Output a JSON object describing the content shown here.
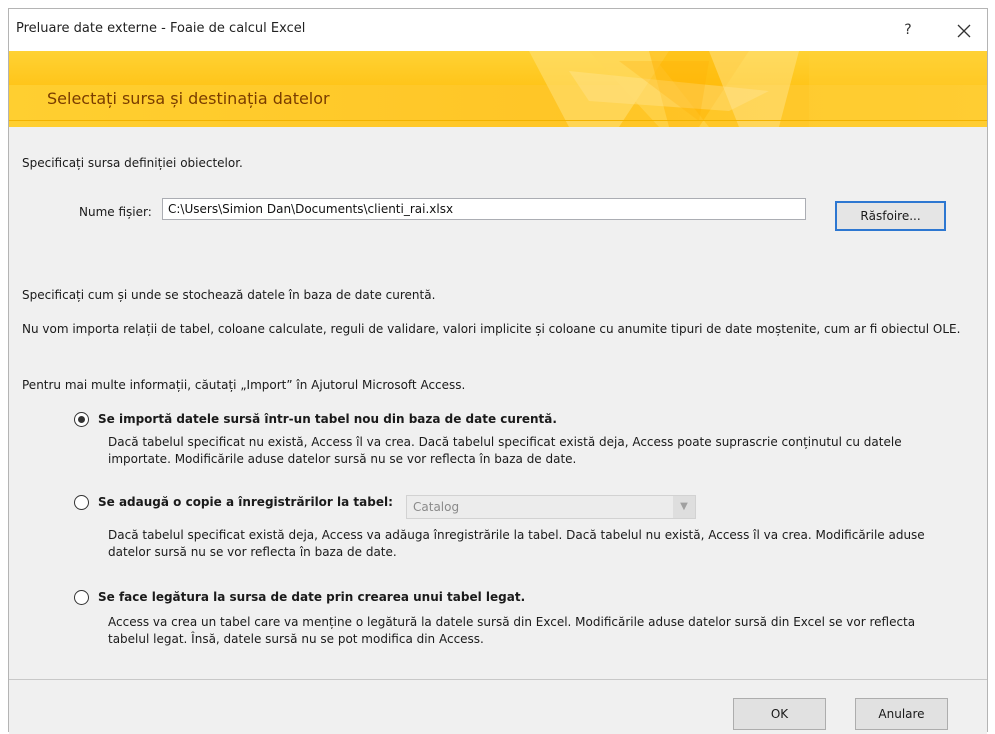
{
  "window": {
    "title": "Preluare date externe - Foaie de calcul Excel",
    "help_label": "?",
    "close_label": "✕"
  },
  "banner": {
    "title": "Selectați sursa și destinația datelor"
  },
  "source": {
    "instruction": "Specificați sursa definiției obiectelor.",
    "file_label": "Nume fișier:",
    "file_value": "C:\\Users\\Simion Dan\\Documents\\clienti_rai.xlsx",
    "browse_label": "Răsfoire..."
  },
  "storage": {
    "instruction": "Specificați cum și unde se stochează datele în baza de date curentă.",
    "note": "Nu vom importa relații de tabel, coloane calculate, reguli de validare, valori implicite și coloane cu anumite tipuri de date moștenite, cum ar fi obiectul OLE.",
    "help_hint": "Pentru mai multe informații, căutați „Import” în Ajutorul Microsoft Access."
  },
  "options": [
    {
      "label": "Se importă datele sursă într-un tabel nou din baza de date curentă.",
      "description": "Dacă tabelul specificat nu există, Access îl va crea. Dacă tabelul specificat există deja, Access poate suprascrie conținutul cu datele importate. Modificările aduse datelor sursă nu se vor reflecta în baza de date.",
      "checked": true
    },
    {
      "label": "Se adaugă o copie a înregistrărilor la tabel:",
      "description": "Dacă tabelul specificat există deja, Access va adăuga înregistrările la tabel. Dacă tabelul nu există, Access îl va crea. Modificările aduse datelor sursă nu se vor reflecta în baza de date.",
      "checked": false,
      "combo_value": "Catalog"
    },
    {
      "label": "Se face legătura la sursa de date prin crearea unui tabel legat.",
      "description": "Access va crea un tabel care va menține o legătură la datele sursă din Excel. Modificările aduse datelor sursă din Excel se vor reflecta tabelul legat. Însă, datele sursă nu se pot modifica din Access.",
      "checked": false
    }
  ],
  "footer": {
    "ok_label": "OK",
    "cancel_label": "Anulare"
  },
  "colors": {
    "banner": "#ffc51a",
    "banner_text": "#7a3d00",
    "focus_border": "#2d77d1"
  },
  "icons": {
    "help": "question-mark",
    "close": "close-icon",
    "combo_arrow": "chevron-down-icon"
  }
}
